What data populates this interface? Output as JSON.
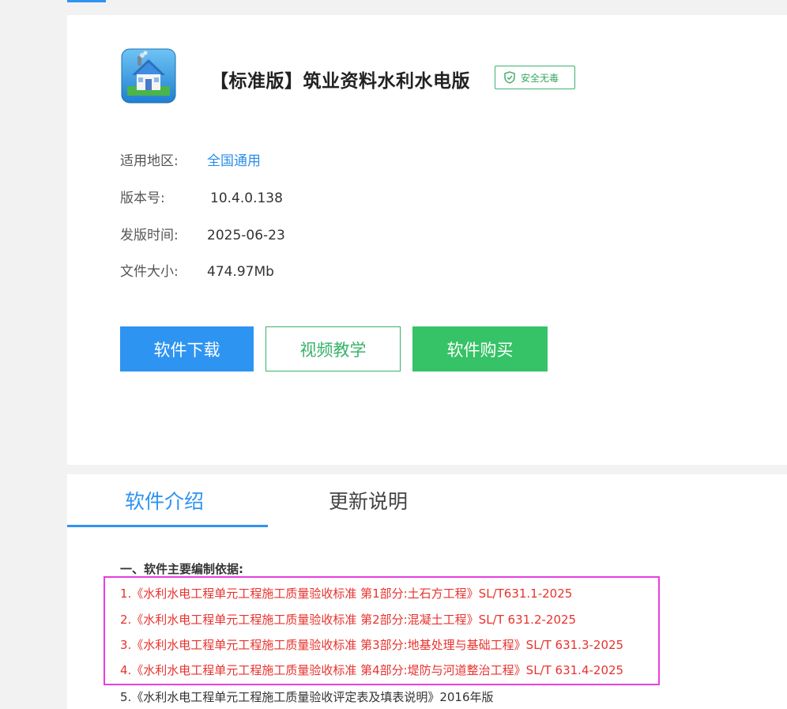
{
  "app": {
    "title": "【标准版】筑业资料水利水电版",
    "safe_badge": "安全无毒",
    "icon": "house-app-icon"
  },
  "info": {
    "region_label": "适用地区:",
    "region_value": "全国通用",
    "version_label": "版本号:",
    "version_value": "10.4.0.138",
    "release_label": "发版时间:",
    "release_value": "2025-06-23",
    "size_label": "文件大小:",
    "size_value": "474.97Mb"
  },
  "buttons": {
    "download": "软件下载",
    "video": "视频教学",
    "buy": "软件购买"
  },
  "tabs": {
    "intro": "软件介绍",
    "update": "更新说明"
  },
  "intro": {
    "heading": "一、软件主要编制依据:",
    "items": [
      "1.《水利水电工程单元工程施工质量验收标准 第1部分:土石方工程》SL/T631.1-2025",
      "2.《水利水电工程单元工程施工质量验收标准 第2部分:混凝土工程》SL/T 631.2-2025",
      "3.《水利水电工程单元工程施工质量验收标准 第3部分:地基处理与基础工程》SL/T 631.3-2025",
      "4.《水利水电工程单元工程施工质量验收标准 第4部分:堤防与河道整治工程》SL/T 631.4-2025",
      "5.《水利水电工程单元工程施工质量验收评定表及填表说明》2016年版"
    ]
  },
  "colors": {
    "accent_blue": "#2f93f0",
    "green": "#36c266",
    "red_text": "#e8322d",
    "highlight_magenta": "#e83fe0"
  }
}
